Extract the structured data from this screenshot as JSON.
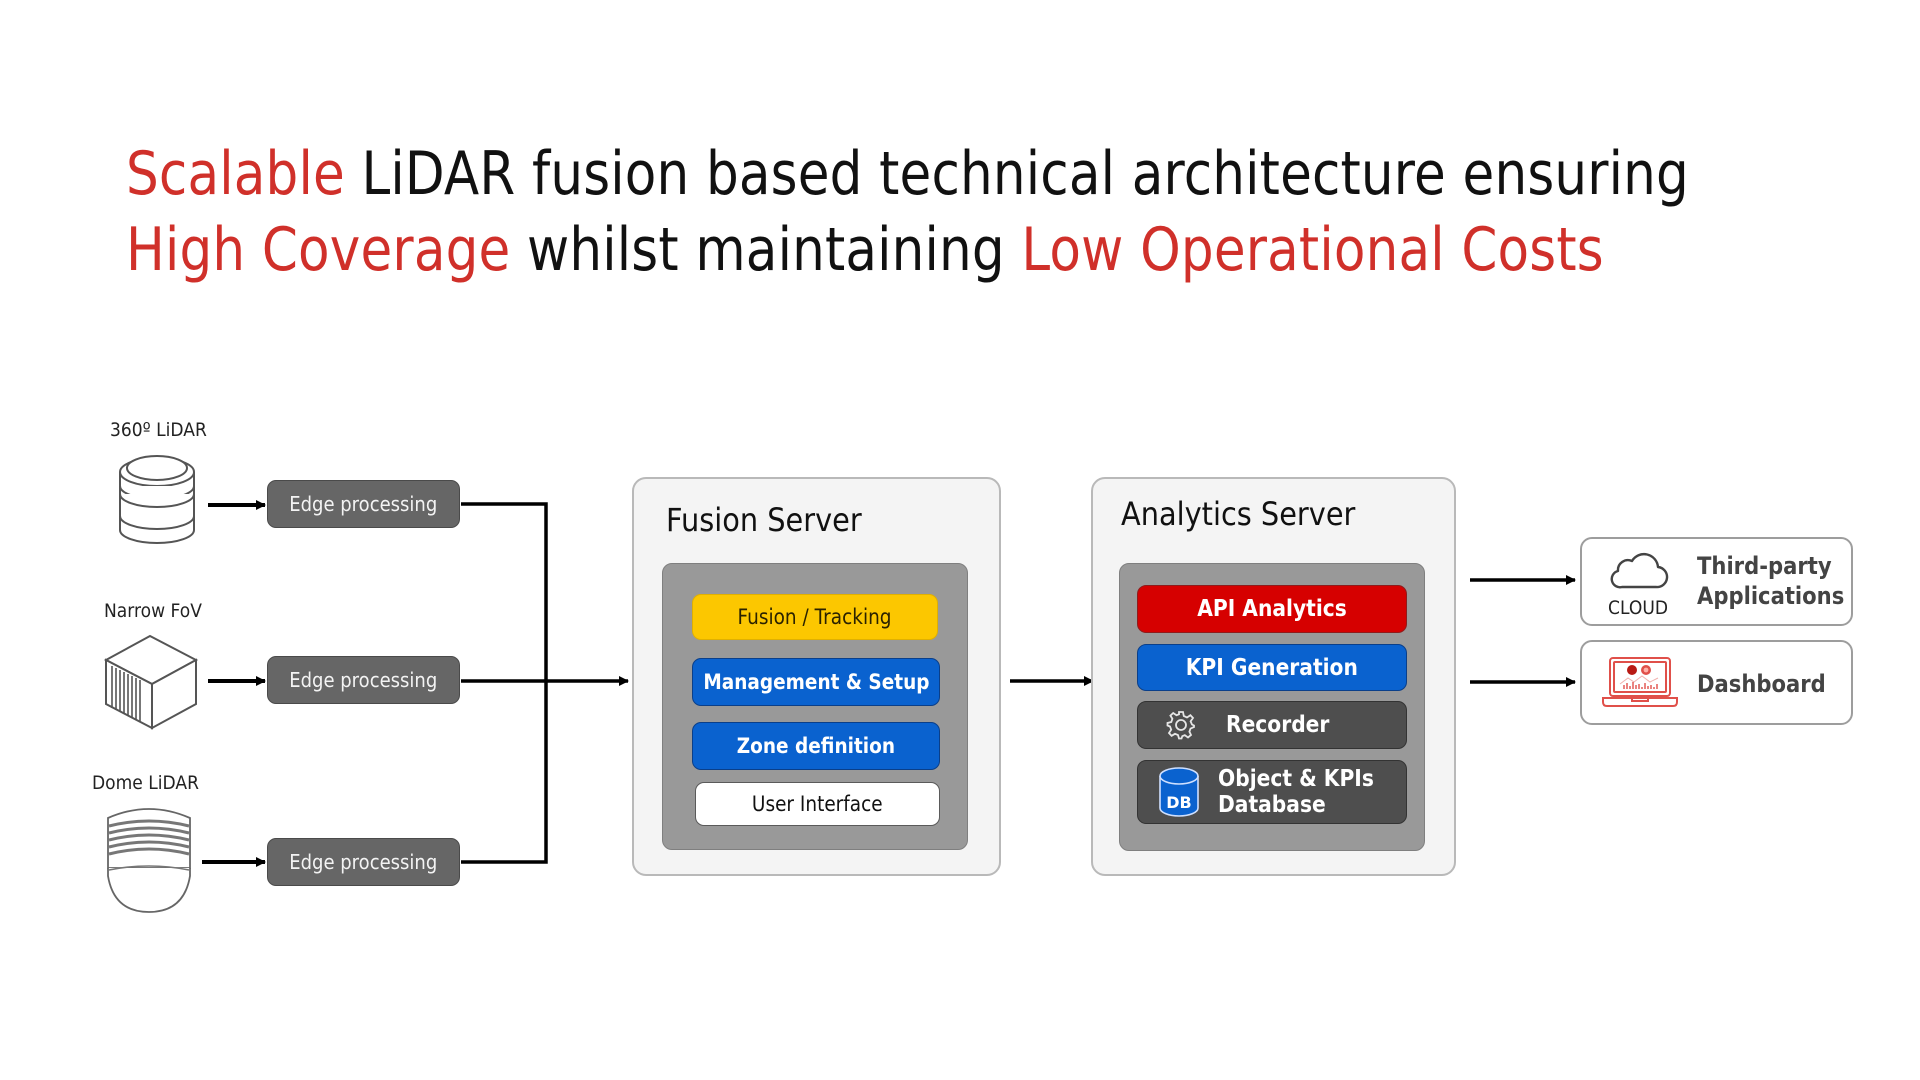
{
  "title": {
    "line1": [
      {
        "text": "Scalable",
        "highlight": true
      },
      {
        "text": " LiDAR fusion based technical architecture ensuring",
        "highlight": false
      }
    ],
    "line2": [
      {
        "text": "High Coverage",
        "highlight": true
      },
      {
        "text": " whilst maintaining ",
        "highlight": false
      },
      {
        "text": "Low Operational Costs",
        "highlight": true
      }
    ],
    "highlight_color": "#d0302a"
  },
  "sensors": [
    {
      "label": "360º LiDAR",
      "icon": "cylinder-lidar-icon",
      "processing": "Edge processing"
    },
    {
      "label": "Narrow FoV",
      "icon": "cube-lidar-icon",
      "processing": "Edge processing"
    },
    {
      "label": "Dome LiDAR",
      "icon": "dome-lidar-icon",
      "processing": "Edge processing"
    }
  ],
  "fusion_server": {
    "title": "Fusion Server",
    "modules": [
      {
        "label": "Fusion / Tracking",
        "style": "yellow"
      },
      {
        "label": "Management & Setup",
        "style": "blue"
      },
      {
        "label": "Zone definition",
        "style": "blue"
      },
      {
        "label": "User Interface",
        "style": "white"
      }
    ]
  },
  "analytics_server": {
    "title": "Analytics Server",
    "modules": [
      {
        "label": "API Analytics",
        "style": "red"
      },
      {
        "label": "KPI Generation",
        "style": "blue"
      },
      {
        "label": "Recorder",
        "style": "dark",
        "icon": "gear-icon"
      },
      {
        "label_line1": "Object & KPIs",
        "label_line2": "Database",
        "style": "dark",
        "icon": "database-icon",
        "icon_text": "DB"
      }
    ]
  },
  "outputs": [
    {
      "line1": "Third-party",
      "line2": "Applications",
      "icon": "cloud-icon",
      "caption": "CLOUD"
    },
    {
      "label": "Dashboard",
      "icon": "laptop-dashboard-icon"
    }
  ],
  "colors": {
    "accent_red": "#d0302a",
    "yellow": "#fcc700",
    "blue": "#0a62cf",
    "red_module": "#d60000",
    "dark_module": "#4e4e4e",
    "edge_box": "#666666",
    "dashboard_icon": "#e0504a"
  }
}
